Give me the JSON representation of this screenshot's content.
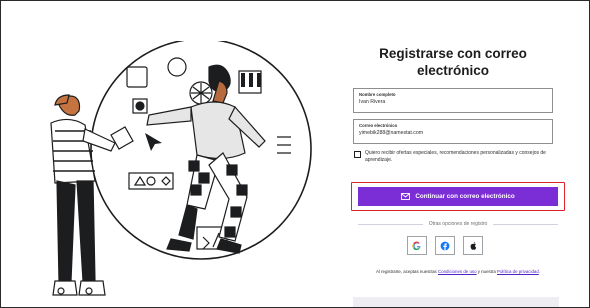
{
  "form": {
    "title_line1": "Registrarse con correo",
    "title_line2": "electrónico",
    "name_field": {
      "label": "Nombre completo",
      "value": "Ivan Rivera"
    },
    "email_field": {
      "label": "Correo electrónico",
      "value": "yimebik288@namestat.com"
    },
    "offers_checkbox": {
      "label": "Quiero recibir ofertas especiales, recomendaciones personalizadas y consejos de aprendizaje.",
      "checked": false
    },
    "submit_button": {
      "label": "Continuar con correo electrónico",
      "icon": "mail-icon"
    },
    "other_options_label": "Otras opciones de registro",
    "social": [
      {
        "name": "Google",
        "icon": "google-icon"
      },
      {
        "name": "Facebook",
        "icon": "facebook-icon"
      },
      {
        "name": "Apple",
        "icon": "apple-icon"
      }
    ],
    "legal": {
      "prefix": "Al registrarte, aceptas nuestras ",
      "terms_link": "Condiciones de uso",
      "middle": " y nuestra ",
      "privacy_link": "Política de privacidad",
      "suffix": "."
    }
  },
  "colors": {
    "primary": "#7b2ed6",
    "highlight": "#d9262b",
    "link": "#5022c3"
  }
}
